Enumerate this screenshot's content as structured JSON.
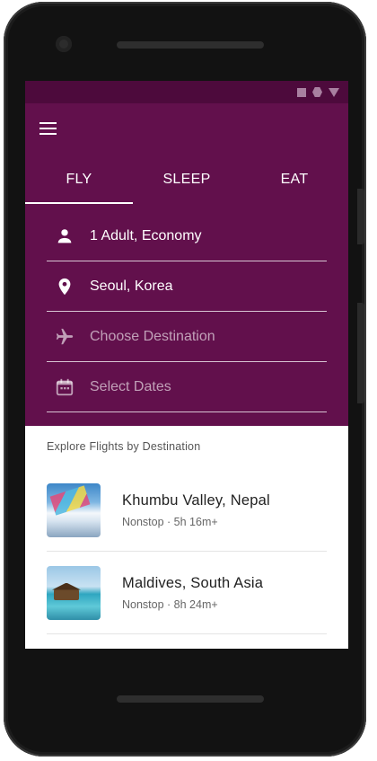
{
  "colors": {
    "primary": "#62104c",
    "status_bar": "#4d0a3c",
    "on_primary": "#ffffff"
  },
  "tabs": [
    {
      "label": "FLY",
      "active": true
    },
    {
      "label": "SLEEP",
      "active": false
    },
    {
      "label": "EAT",
      "active": false
    }
  ],
  "fields": {
    "travelers": {
      "value": "1 Adult, Economy",
      "icon": "person-icon"
    },
    "origin": {
      "value": "Seoul, Korea",
      "icon": "location-pin-icon"
    },
    "destination": {
      "placeholder": "Choose Destination",
      "icon": "airplane-icon"
    },
    "dates": {
      "placeholder": "Select Dates",
      "icon": "calendar-icon"
    }
  },
  "explore": {
    "title": "Explore Flights by Destination",
    "items": [
      {
        "name": "Khumbu Valley, Nepal",
        "meta": "Nonstop · 5h 16m+"
      },
      {
        "name": "Maldives, South Asia",
        "meta": "Nonstop · 8h 24m+"
      }
    ]
  }
}
